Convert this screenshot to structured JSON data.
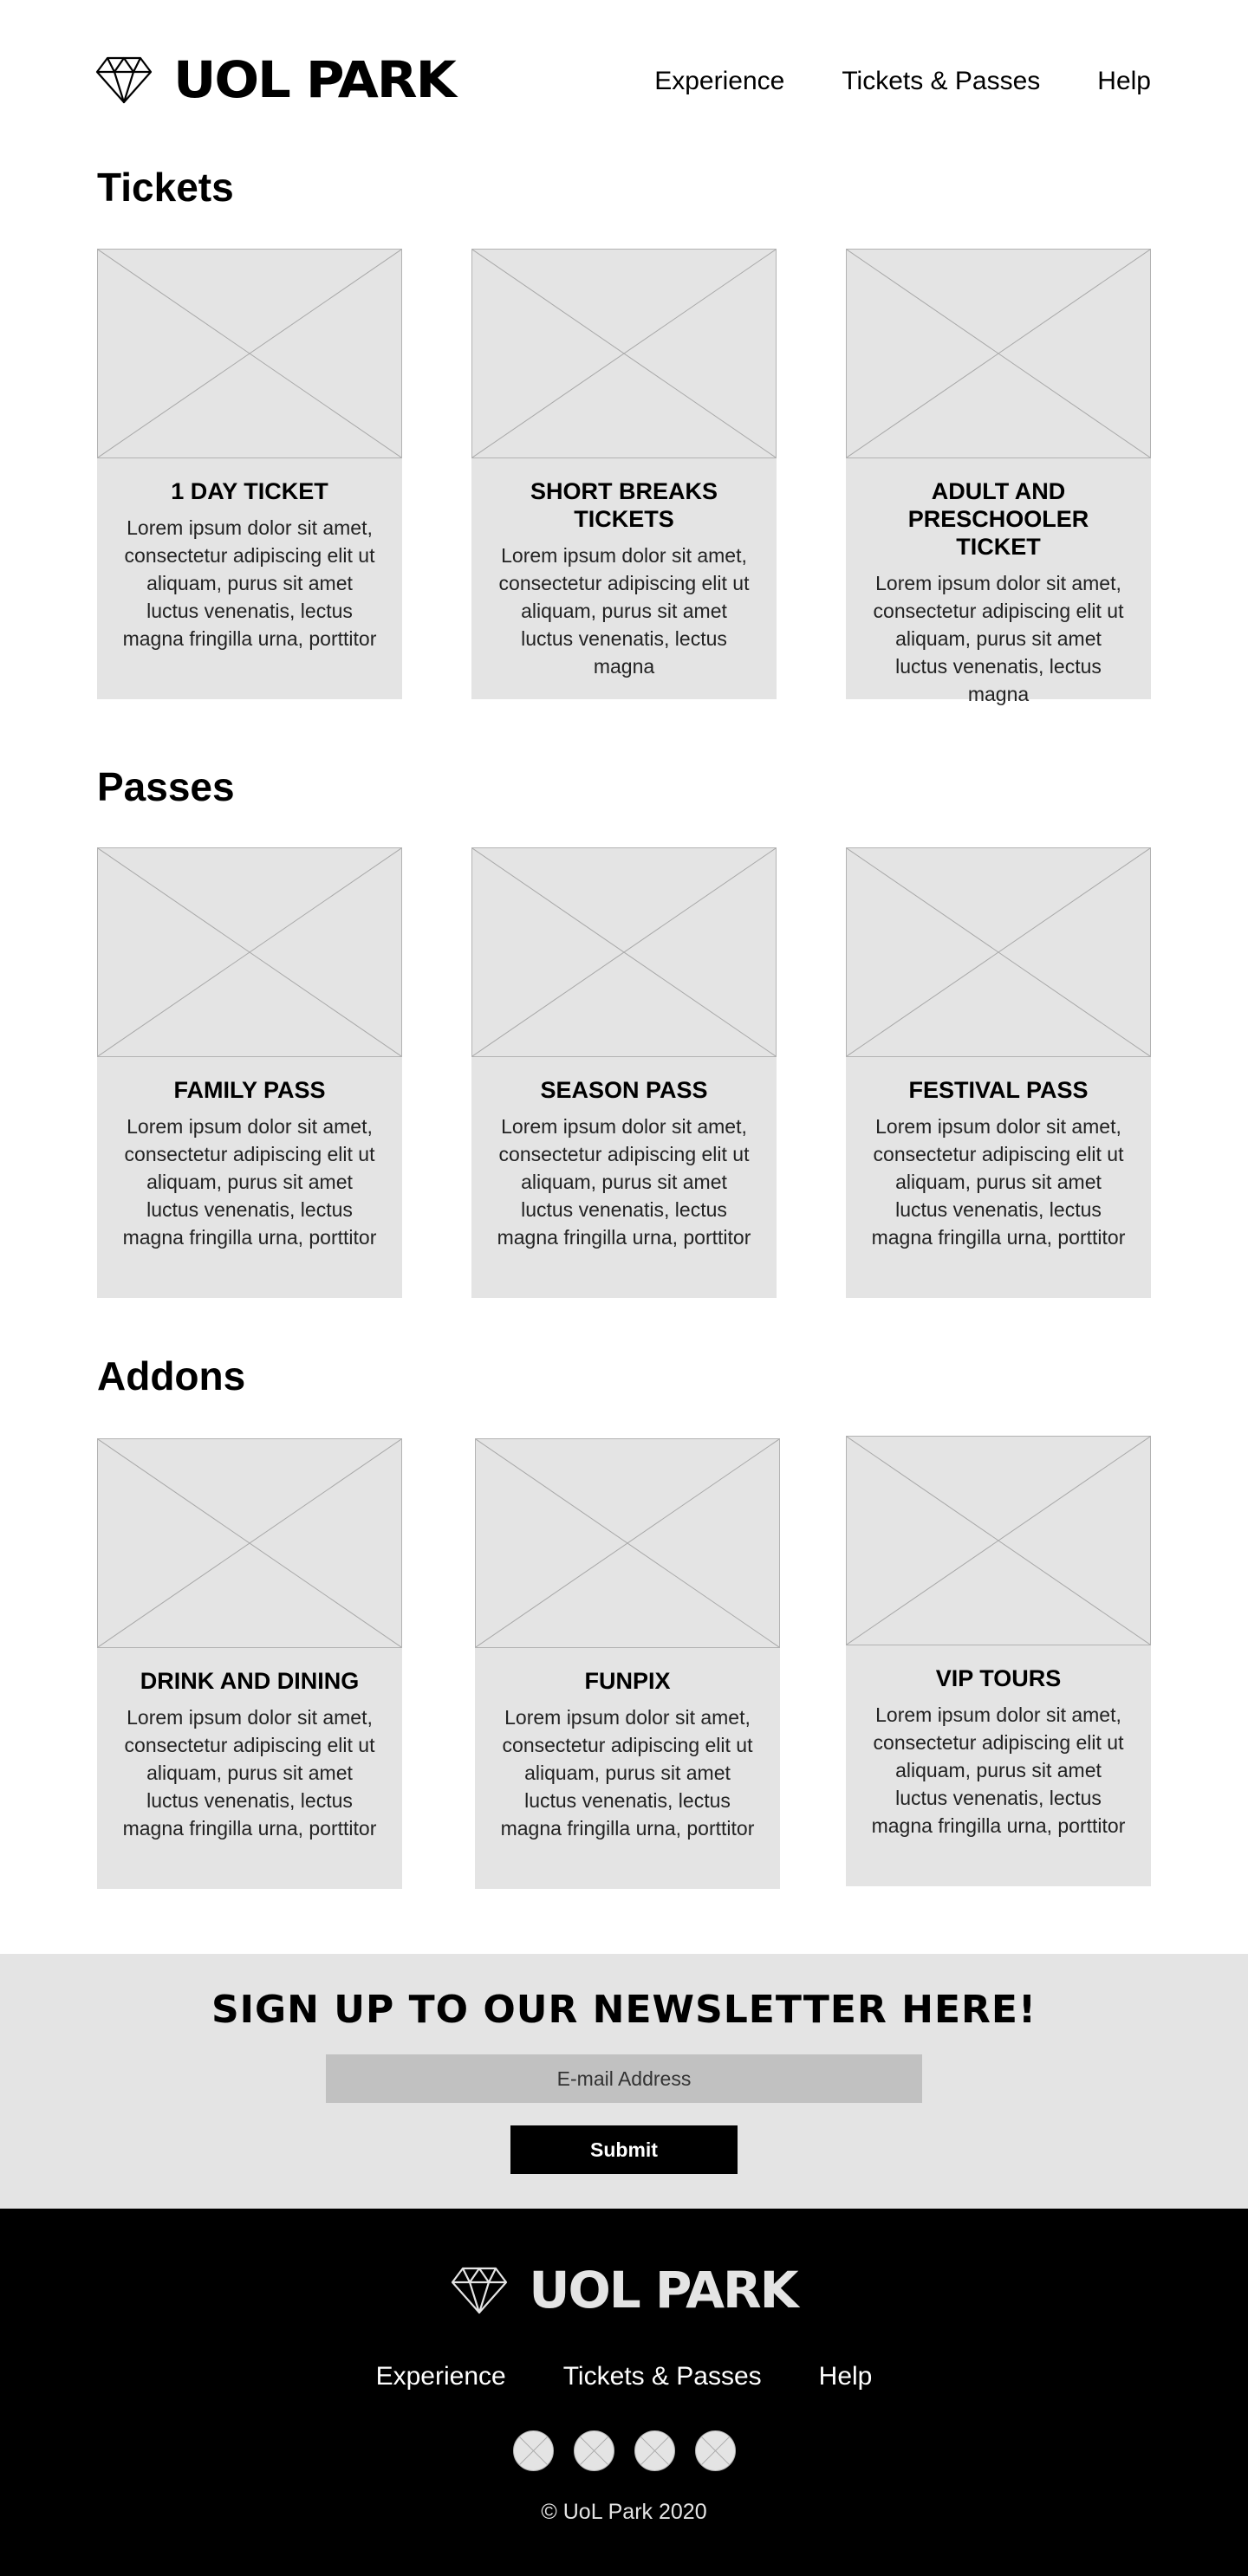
{
  "header": {
    "brand": "UOL PARK",
    "nav": [
      "Experience",
      "Tickets & Passes",
      "Help"
    ]
  },
  "sections": [
    {
      "title": "Tickets",
      "cards": [
        {
          "title": "1 DAY TICKET",
          "body": "Lorem ipsum dolor sit amet, consectetur adipiscing elit ut aliquam, purus sit amet luctus venenatis, lectus magna fringilla urna, porttitor"
        },
        {
          "title": "SHORT BREAKS TICKETS",
          "body": "Lorem ipsum dolor sit amet, consectetur adipiscing elit ut aliquam, purus sit amet luctus venenatis, lectus magna"
        },
        {
          "title": "ADULT AND PRESCHOOLER TICKET",
          "body": "Lorem ipsum dolor sit amet, consectetur adipiscing elit ut aliquam, purus sit amet luctus venenatis, lectus magna"
        }
      ]
    },
    {
      "title": "Passes",
      "cards": [
        {
          "title": "FAMILY PASS",
          "body": "Lorem ipsum dolor sit amet, consectetur adipiscing elit ut aliquam, purus sit amet luctus venenatis, lectus magna fringilla urna, porttitor"
        },
        {
          "title": "SEASON PASS",
          "body": "Lorem ipsum dolor sit amet, consectetur adipiscing elit ut aliquam, purus sit amet luctus venenatis, lectus magna fringilla urna, porttitor"
        },
        {
          "title": "FESTIVAL PASS",
          "body": "Lorem ipsum dolor sit amet, consectetur adipiscing elit ut aliquam, purus sit amet luctus venenatis, lectus magna fringilla urna, porttitor"
        }
      ]
    },
    {
      "title": "Addons",
      "cards": [
        {
          "title": "DRINK AND DINING",
          "body": "Lorem ipsum dolor sit amet, consectetur adipiscing elit ut aliquam, purus sit amet luctus venenatis, lectus magna fringilla urna, porttitor"
        },
        {
          "title": "FUNPIX",
          "body": "Lorem ipsum dolor sit amet, consectetur adipiscing elit ut aliquam, purus sit amet luctus venenatis, lectus magna fringilla urna, porttitor"
        },
        {
          "title": "VIP TOURS",
          "body": "Lorem ipsum dolor sit amet, consectetur adipiscing elit ut aliquam, purus sit amet luctus venenatis, lectus magna fringilla urna, porttitor"
        }
      ]
    }
  ],
  "newsletter": {
    "title": "SIGN UP TO OUR NEWSLETTER HERE!",
    "email_placeholder": "E-mail Address",
    "submit_label": "Submit"
  },
  "footer": {
    "brand": "UOL PARK",
    "nav": [
      "Experience",
      "Tickets & Passes",
      "Help"
    ],
    "copyright": "© UoL Park 2020"
  },
  "colors": {
    "placeholder_gray": "#e4e4e4",
    "input_gray": "#c1c1c1",
    "footer_bg": "#000000"
  }
}
